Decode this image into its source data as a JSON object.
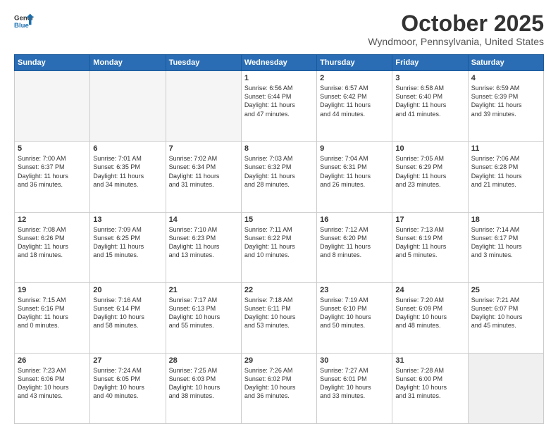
{
  "logo": {
    "line1": "General",
    "line2": "Blue"
  },
  "title": "October 2025",
  "location": "Wyndmoor, Pennsylvania, United States",
  "days_of_week": [
    "Sunday",
    "Monday",
    "Tuesday",
    "Wednesday",
    "Thursday",
    "Friday",
    "Saturday"
  ],
  "weeks": [
    [
      {
        "day": "",
        "empty": true
      },
      {
        "day": "",
        "empty": true
      },
      {
        "day": "",
        "empty": true
      },
      {
        "day": "1",
        "sunrise": "6:56 AM",
        "sunset": "6:44 PM",
        "daylight": "11 hours and 47 minutes."
      },
      {
        "day": "2",
        "sunrise": "6:57 AM",
        "sunset": "6:42 PM",
        "daylight": "11 hours and 44 minutes."
      },
      {
        "day": "3",
        "sunrise": "6:58 AM",
        "sunset": "6:40 PM",
        "daylight": "11 hours and 41 minutes."
      },
      {
        "day": "4",
        "sunrise": "6:59 AM",
        "sunset": "6:39 PM",
        "daylight": "11 hours and 39 minutes."
      }
    ],
    [
      {
        "day": "5",
        "sunrise": "7:00 AM",
        "sunset": "6:37 PM",
        "daylight": "11 hours and 36 minutes."
      },
      {
        "day": "6",
        "sunrise": "7:01 AM",
        "sunset": "6:35 PM",
        "daylight": "11 hours and 34 minutes."
      },
      {
        "day": "7",
        "sunrise": "7:02 AM",
        "sunset": "6:34 PM",
        "daylight": "11 hours and 31 minutes."
      },
      {
        "day": "8",
        "sunrise": "7:03 AM",
        "sunset": "6:32 PM",
        "daylight": "11 hours and 28 minutes."
      },
      {
        "day": "9",
        "sunrise": "7:04 AM",
        "sunset": "6:31 PM",
        "daylight": "11 hours and 26 minutes."
      },
      {
        "day": "10",
        "sunrise": "7:05 AM",
        "sunset": "6:29 PM",
        "daylight": "11 hours and 23 minutes."
      },
      {
        "day": "11",
        "sunrise": "7:06 AM",
        "sunset": "6:28 PM",
        "daylight": "11 hours and 21 minutes."
      }
    ],
    [
      {
        "day": "12",
        "sunrise": "7:08 AM",
        "sunset": "6:26 PM",
        "daylight": "11 hours and 18 minutes."
      },
      {
        "day": "13",
        "sunrise": "7:09 AM",
        "sunset": "6:25 PM",
        "daylight": "11 hours and 15 minutes."
      },
      {
        "day": "14",
        "sunrise": "7:10 AM",
        "sunset": "6:23 PM",
        "daylight": "11 hours and 13 minutes."
      },
      {
        "day": "15",
        "sunrise": "7:11 AM",
        "sunset": "6:22 PM",
        "daylight": "11 hours and 10 minutes."
      },
      {
        "day": "16",
        "sunrise": "7:12 AM",
        "sunset": "6:20 PM",
        "daylight": "11 hours and 8 minutes."
      },
      {
        "day": "17",
        "sunrise": "7:13 AM",
        "sunset": "6:19 PM",
        "daylight": "11 hours and 5 minutes."
      },
      {
        "day": "18",
        "sunrise": "7:14 AM",
        "sunset": "6:17 PM",
        "daylight": "11 hours and 3 minutes."
      }
    ],
    [
      {
        "day": "19",
        "sunrise": "7:15 AM",
        "sunset": "6:16 PM",
        "daylight": "11 hours and 0 minutes."
      },
      {
        "day": "20",
        "sunrise": "7:16 AM",
        "sunset": "6:14 PM",
        "daylight": "10 hours and 58 minutes."
      },
      {
        "day": "21",
        "sunrise": "7:17 AM",
        "sunset": "6:13 PM",
        "daylight": "10 hours and 55 minutes."
      },
      {
        "day": "22",
        "sunrise": "7:18 AM",
        "sunset": "6:11 PM",
        "daylight": "10 hours and 53 minutes."
      },
      {
        "day": "23",
        "sunrise": "7:19 AM",
        "sunset": "6:10 PM",
        "daylight": "10 hours and 50 minutes."
      },
      {
        "day": "24",
        "sunrise": "7:20 AM",
        "sunset": "6:09 PM",
        "daylight": "10 hours and 48 minutes."
      },
      {
        "day": "25",
        "sunrise": "7:21 AM",
        "sunset": "6:07 PM",
        "daylight": "10 hours and 45 minutes."
      }
    ],
    [
      {
        "day": "26",
        "sunrise": "7:23 AM",
        "sunset": "6:06 PM",
        "daylight": "10 hours and 43 minutes."
      },
      {
        "day": "27",
        "sunrise": "7:24 AM",
        "sunset": "6:05 PM",
        "daylight": "10 hours and 40 minutes."
      },
      {
        "day": "28",
        "sunrise": "7:25 AM",
        "sunset": "6:03 PM",
        "daylight": "10 hours and 38 minutes."
      },
      {
        "day": "29",
        "sunrise": "7:26 AM",
        "sunset": "6:02 PM",
        "daylight": "10 hours and 36 minutes."
      },
      {
        "day": "30",
        "sunrise": "7:27 AM",
        "sunset": "6:01 PM",
        "daylight": "10 hours and 33 minutes."
      },
      {
        "day": "31",
        "sunrise": "7:28 AM",
        "sunset": "6:00 PM",
        "daylight": "10 hours and 31 minutes."
      },
      {
        "day": "",
        "empty": true,
        "shaded": true
      }
    ]
  ]
}
